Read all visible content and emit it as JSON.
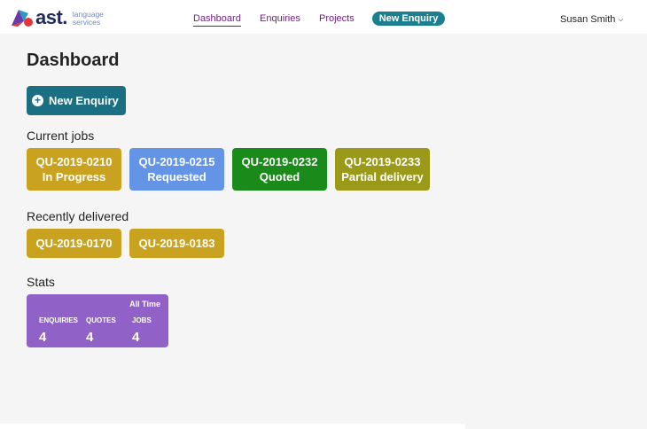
{
  "brand": {
    "name": "ast.",
    "sub_line1": "language",
    "sub_line2": "services"
  },
  "nav": {
    "links": [
      "Dashboard",
      "Enquiries",
      "Projects"
    ],
    "cta": "New Enquiry",
    "user": "Susan Smith"
  },
  "page": {
    "title": "Dashboard",
    "new_enquiry_label": "New Enquiry"
  },
  "current_jobs": {
    "label": "Current jobs",
    "items": [
      {
        "id": "QU-2019-0210",
        "status": "In Progress",
        "color": "#c9a21f"
      },
      {
        "id": "QU-2019-0215",
        "status": "Requested",
        "color": "#6494e6"
      },
      {
        "id": "QU-2019-0232",
        "status": "Quoted",
        "color": "#1a8a1a"
      },
      {
        "id": "QU-2019-0233",
        "status": "Partial delivery",
        "color": "#9a9a18"
      }
    ]
  },
  "recently_delivered": {
    "label": "Recently delivered",
    "items": [
      {
        "id": "QU-2019-0170",
        "color": "#c9a21f"
      },
      {
        "id": "QU-2019-0183",
        "color": "#c9a21f"
      }
    ]
  },
  "stats": {
    "label": "Stats",
    "period": "All Time",
    "enquiries_label": "ENQUIRIES",
    "enquiries_value": "4",
    "quotes_label": "QUOTES",
    "quotes_value": "4",
    "jobs_label": "JOBS",
    "jobs_value": "4",
    "color": "#9062c8"
  },
  "icons": {
    "plus": "plus-circle-icon",
    "chevron": "chevron-down-icon",
    "logo": "ast-logo-mark"
  }
}
